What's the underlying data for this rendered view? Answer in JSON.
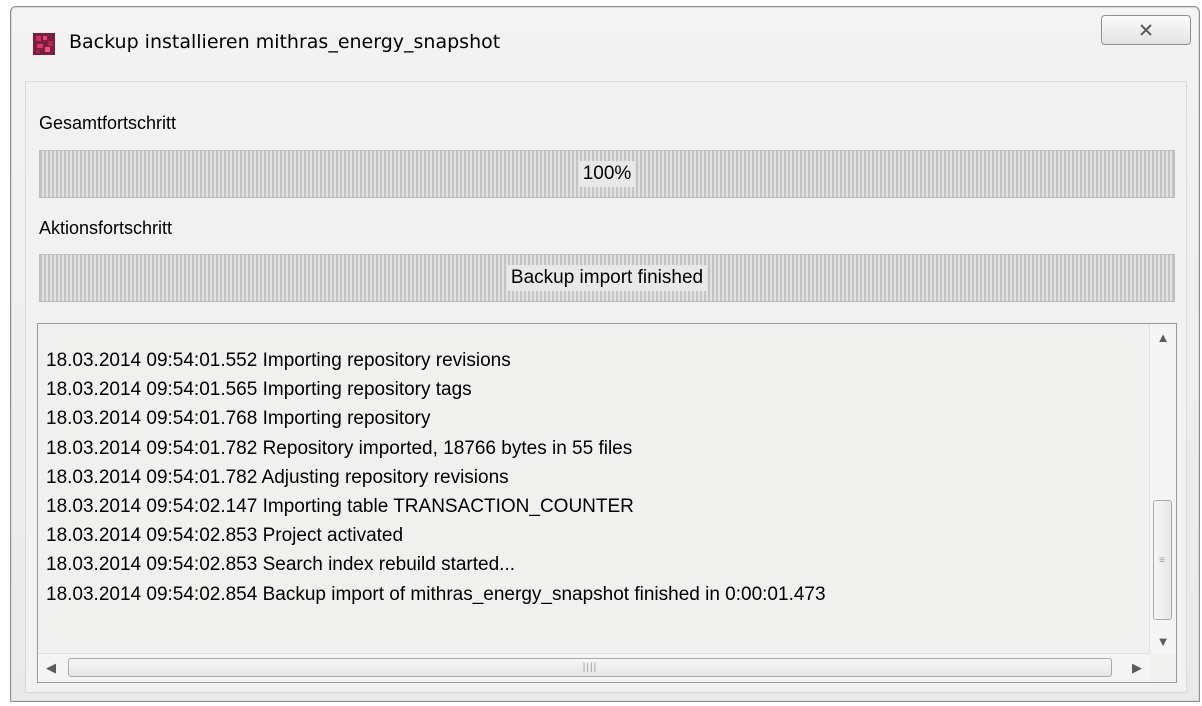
{
  "window": {
    "title": "Backup installieren mithras_energy_snapshot",
    "close_label": "×",
    "app_icon": "firstspirit-app-icon"
  },
  "overall": {
    "label": "Gesamtfortschritt",
    "progress_text": "100%",
    "progress_value": 1.0
  },
  "action": {
    "label": "Aktionsfortschritt",
    "progress_text": "Backup import finished",
    "progress_value": 1.0
  },
  "log": {
    "lines": [
      "18.03.2014 09:54:01.552 Importing repository revisions",
      "18.03.2014 09:54:01.565 Importing repository tags",
      "18.03.2014 09:54:01.768 Importing repository",
      "18.03.2014 09:54:01.782 Repository imported, 18766 bytes in 55 files",
      "18.03.2014 09:54:01.782 Adjusting repository revisions",
      "18.03.2014 09:54:02.147 Importing table TRANSACTION_COUNTER",
      "18.03.2014 09:54:02.853 Project activated",
      "18.03.2014 09:54:02.853 Search index rebuild started...",
      "18.03.2014 09:54:02.854 Backup import of mithras_energy_snapshot finished in 0:00:01.473"
    ]
  },
  "scrollbars": {
    "up_icon": "▲",
    "down_icon": "▼",
    "left_icon": "◀",
    "right_icon": "▶",
    "v_grip": "≡",
    "h_grip": "||||"
  }
}
